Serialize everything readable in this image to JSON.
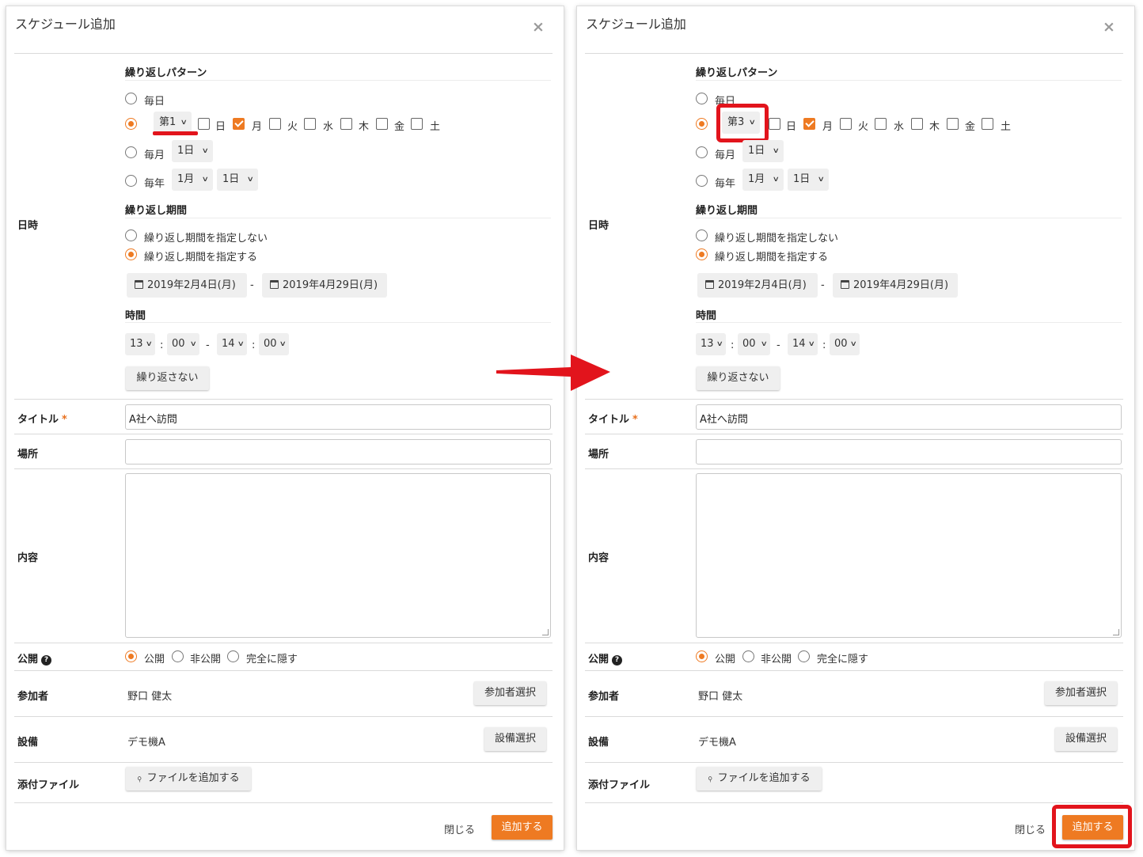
{
  "dialog": {
    "title": "スケジュール追加",
    "close_icon": "×"
  },
  "labels": {
    "datetime": "日時",
    "title": "タイトル",
    "required": "*",
    "place": "場所",
    "content": "内容",
    "publish": "公開",
    "participants": "参加者",
    "equipment": "設備",
    "attachment": "添付ファイル"
  },
  "repeat": {
    "section_title": "繰り返しパターン",
    "daily": "毎日",
    "monthly": "毎月",
    "yearly": "毎年",
    "weekdays": [
      "日",
      "月",
      "火",
      "水",
      "木",
      "金",
      "土"
    ],
    "weekdays_checked": [
      false,
      true,
      false,
      false,
      false,
      false,
      false
    ],
    "monthly_day": "1日",
    "yearly_month": "1月",
    "yearly_day": "1日"
  },
  "panels": [
    {
      "week_ordinal": "第1"
    },
    {
      "week_ordinal": "第3"
    }
  ],
  "period": {
    "section_title": "繰り返し期間",
    "no_period": "繰り返し期間を指定しない",
    "with_period": "繰り返し期間を指定する",
    "start_date": "2019年2月4日(月)",
    "separator": "-",
    "end_date": "2019年4月29日(月)"
  },
  "time": {
    "section_title": "時間",
    "start_hour": "13",
    "start_min": "00",
    "end_hour": "14",
    "end_min": "00",
    "colon": ":",
    "dash": "-",
    "no_repeat_button": "繰り返さない"
  },
  "form": {
    "title_value": "A社へ訪問",
    "place_value": "",
    "content_value": ""
  },
  "publish": {
    "public": "公開",
    "private": "非公開",
    "hidden": "完全に隠す",
    "help_icon": "?"
  },
  "participants": {
    "value": "野口 健太",
    "button": "参加者選択"
  },
  "equipment": {
    "value": "デモ機A",
    "button": "設備選択"
  },
  "attachment": {
    "button": "ファイルを追加する"
  },
  "footer": {
    "close": "閉じる",
    "add": "追加する"
  },
  "colors": {
    "accent": "#ee7a22",
    "highlight": "#e2141c"
  }
}
